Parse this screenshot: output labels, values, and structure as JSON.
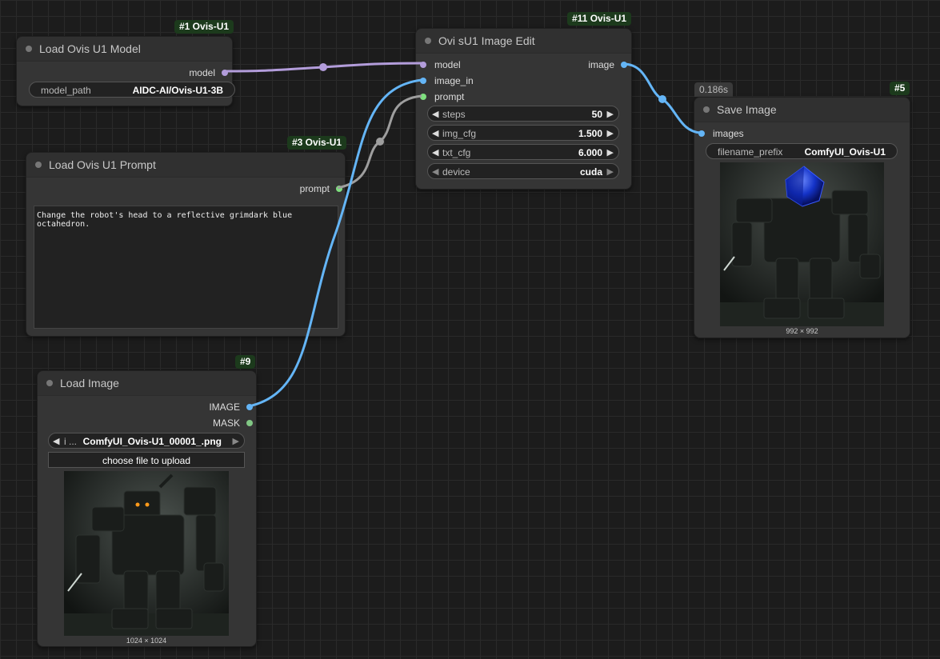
{
  "colors": {
    "model_wire": "#b39ddb",
    "image_wire": "#64b5f6",
    "prompt_wire": "#9e9e9e",
    "model_slot": "#b39ddb",
    "image_slot": "#64b5f6",
    "prompt_slot": "#7ee07e",
    "mask_slot": "#81c784",
    "badge_bg": "#1c3a1c"
  },
  "nodes": {
    "load_model": {
      "badge": "#1 Ovis-U1",
      "title": "Load Ovis U1 Model",
      "output": "model",
      "widget_label": "model_path",
      "widget_value": "AIDC-AI/Ovis-U1-3B"
    },
    "load_prompt": {
      "badge": "#3 Ovis-U1",
      "title": "Load Ovis U1 Prompt",
      "output": "prompt",
      "text": "Change the robot's head to a reflective grimdark blue octahedron."
    },
    "image_edit": {
      "badge": "#11 Ovis-U1",
      "title": "Ovi sU1 Image Edit",
      "inputs": [
        "model",
        "image_in",
        "prompt"
      ],
      "output": "image",
      "widgets": [
        {
          "label": "steps",
          "value": "50"
        },
        {
          "label": "img_cfg",
          "value": "1.500"
        },
        {
          "label": "txt_cfg",
          "value": "6.000"
        },
        {
          "label": "device",
          "value": "cuda"
        }
      ]
    },
    "save_image": {
      "time": "0.186s",
      "badge": "#5",
      "title": "Save Image",
      "input": "images",
      "widget_label": "filename_prefix",
      "widget_value": "ComfyUI_Ovis-U1",
      "caption": "992 × 992"
    },
    "load_image": {
      "badge": "#9",
      "title": "Load Image",
      "outputs": [
        "IMAGE",
        "MASK"
      ],
      "combo_label": "i ...",
      "combo_value": "ComfyUI_Ovis-U1_00001_.png",
      "upload_label": "choose file to upload",
      "caption": "1024 × 1024"
    }
  },
  "arrows": {
    "left": "◀",
    "right": "▶"
  }
}
